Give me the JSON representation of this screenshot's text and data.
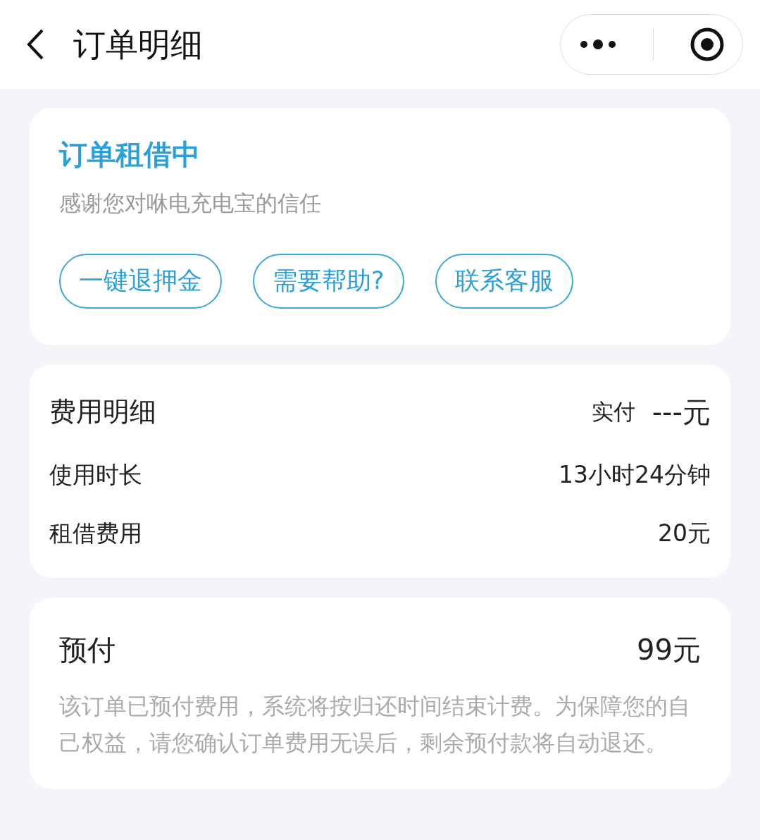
{
  "header": {
    "title": "订单明细"
  },
  "status_card": {
    "title": "订单租借中",
    "subtitle": "感谢您对咻电充电宝的信任",
    "buttons": [
      "一键退押金",
      "需要帮助?",
      "联系客服"
    ]
  },
  "fee_card": {
    "title": "费用明细",
    "paid_label": "实付",
    "paid_value": "---元",
    "rows": [
      {
        "label": "使用时长",
        "value": "13小时24分钟"
      },
      {
        "label": "租借费用",
        "value": "20元"
      }
    ]
  },
  "prepay_card": {
    "title": "预付",
    "amount": "99元",
    "note": "该订单已预付费用，系统将按归还时间结束计费。为保障您的自己权益，请您确认订单费用无误后，剩余预付款将自动退还。"
  }
}
